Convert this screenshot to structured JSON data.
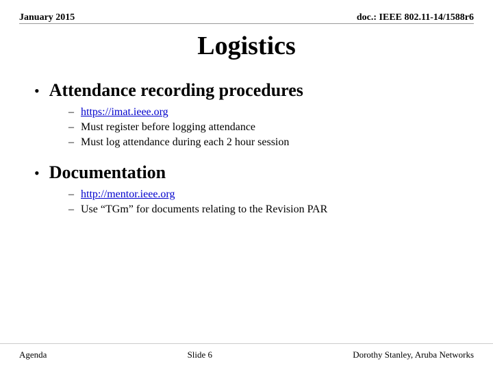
{
  "header": {
    "left": "January 2015",
    "right": "doc.: IEEE 802.11-14/1588r6"
  },
  "title": "Logistics",
  "bullets": [
    {
      "id": "attendance",
      "label": "Attendance recording procedures",
      "sub": [
        {
          "id": "link1",
          "text": "https://imat.ieee.org",
          "isLink": true
        },
        {
          "id": "register",
          "text": "Must register before logging attendance",
          "isLink": false
        },
        {
          "id": "log",
          "text": "Must log attendance during each 2 hour session",
          "isLink": false
        }
      ]
    },
    {
      "id": "documentation",
      "label": "Documentation",
      "sub": [
        {
          "id": "link2",
          "text": "http://mentor.ieee.org",
          "isLink": true
        },
        {
          "id": "tgm",
          "text": "Use “TGm” for documents relating to the Revision PAR",
          "isLink": false
        }
      ]
    }
  ],
  "footer": {
    "left": "Agenda",
    "center": "Slide 6",
    "right": "Dorothy Stanley, Aruba Networks"
  }
}
